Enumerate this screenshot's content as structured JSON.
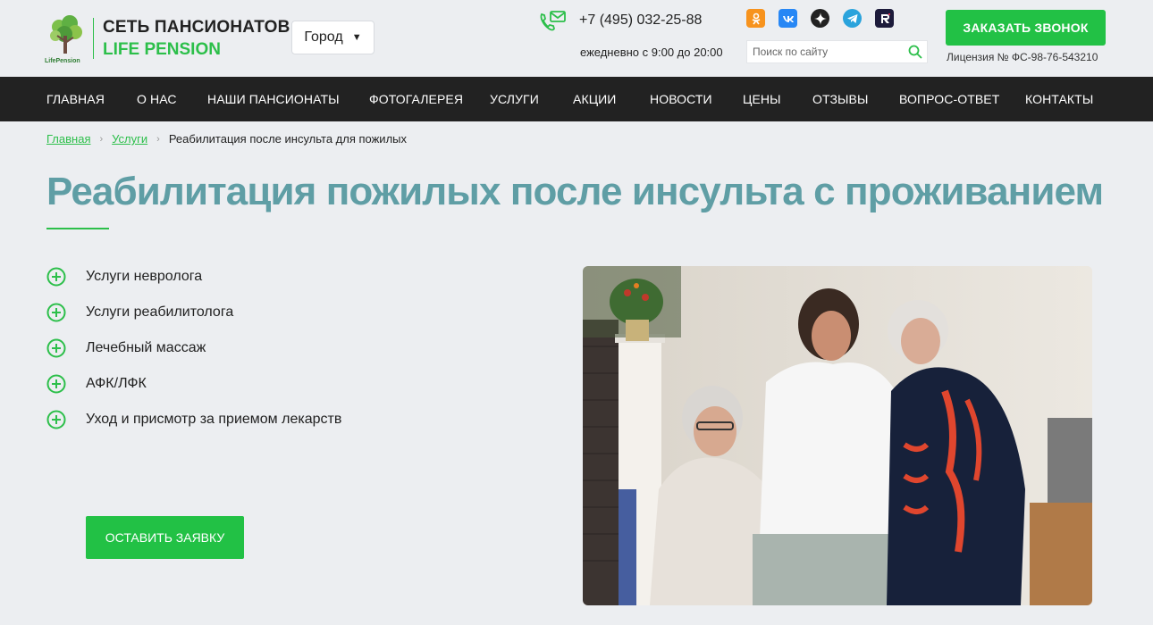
{
  "header": {
    "logo_small_text": "LifePension",
    "brand_line1": "СЕТЬ ПАНСИОНАТОВ",
    "brand_line2": "LIFE PENSION",
    "city_select": "Город",
    "phone": "+7 (495) 032-25-88",
    "hours": "ежедневно с 9:00 до 20:00",
    "search_placeholder": "Поиск по сайту",
    "call_button": "ЗАКАЗАТЬ ЗВОНОК",
    "license": "Лицензия № ФС-98-76-543210",
    "socials": [
      "odnoklassniki-icon",
      "vk-icon",
      "dzen-icon",
      "telegram-icon",
      "rutube-icon"
    ],
    "accent_color": "#22c145"
  },
  "nav": {
    "items": [
      "ГЛАВНАЯ",
      "О НАС",
      "НАШИ ПАНСИОНАТЫ",
      "ФОТОГАЛЕРЕЯ",
      "УСЛУГИ",
      "АКЦИИ",
      "НОВОСТИ",
      "ЦЕНЫ",
      "ОТЗЫВЫ",
      "ВОПРОС-ОТВЕТ",
      "КОНТАКТЫ"
    ]
  },
  "breadcrumb": {
    "home": "Главная",
    "services": "Услуги",
    "current": "Реабилитация после инсульта для пожилых"
  },
  "main": {
    "title": "Реабилитация пожилых после инсульта с проживанием",
    "title_color": "#5f9ea5",
    "features": [
      "Услуги невролога",
      "Услуги реабилитолога",
      "Лечебный массаж",
      "АФК/ЛФК",
      "Уход и присмотр за приемом лекарств"
    ],
    "apply_button": "ОСТАВИТЬ ЗАЯВКУ"
  }
}
